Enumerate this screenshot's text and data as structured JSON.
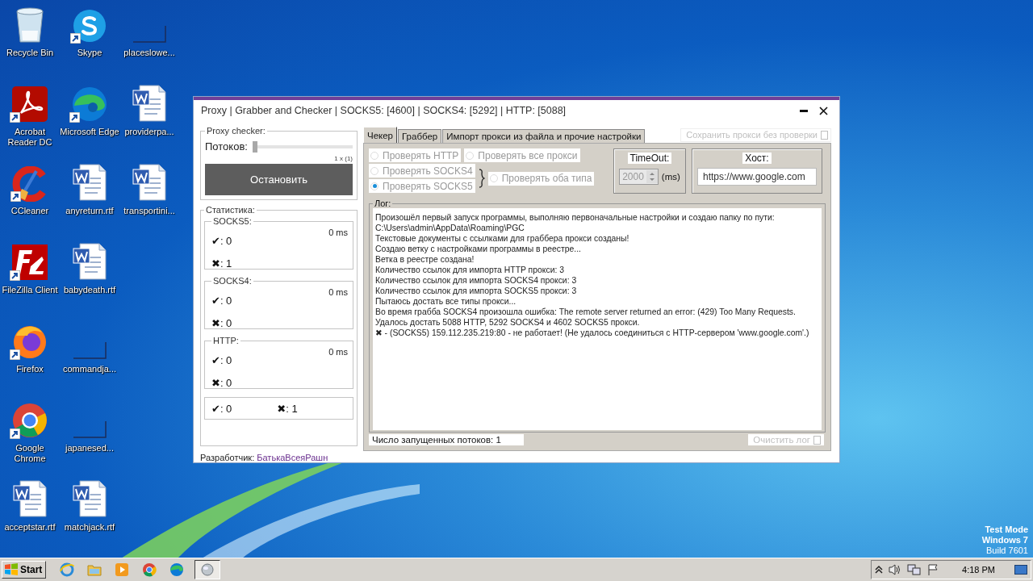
{
  "desktop": {
    "columns": [
      {
        "icons": [
          {
            "label": "Recycle Bin",
            "kind": "recycle",
            "shortcut": false
          },
          {
            "label": "Acrobat Reader DC",
            "kind": "pdf",
            "shortcut": true
          },
          {
            "label": "CCleaner",
            "kind": "ccleaner",
            "shortcut": true
          },
          {
            "label": "FileZilla Client",
            "kind": "filezilla",
            "shortcut": true
          },
          {
            "label": "Firefox",
            "kind": "firefox",
            "shortcut": true
          },
          {
            "label": "Google Chrome",
            "kind": "chrome",
            "shortcut": true
          },
          {
            "label": "acceptstar.rtf",
            "kind": "word",
            "shortcut": false
          }
        ]
      },
      {
        "icons": [
          {
            "label": "Skype",
            "kind": "skype",
            "shortcut": true
          },
          {
            "label": "Microsoft Edge",
            "kind": "edge",
            "shortcut": true
          },
          {
            "label": "anyreturn.rtf",
            "kind": "word",
            "shortcut": false
          },
          {
            "label": "babydeath.rtf",
            "kind": "word",
            "shortcut": false
          },
          {
            "label": "commandja...",
            "kind": "blank",
            "shortcut": false
          },
          {
            "label": "japanesed...",
            "kind": "blank",
            "shortcut": false
          },
          {
            "label": "matchjack.rtf",
            "kind": "word",
            "shortcut": false
          }
        ]
      },
      {
        "icons": [
          {
            "label": "placeslowe...",
            "kind": "blank",
            "shortcut": false
          },
          {
            "label": "providerpa...",
            "kind": "word",
            "shortcut": false
          },
          {
            "label": "transportini...",
            "kind": "word",
            "shortcut": false
          }
        ]
      }
    ]
  },
  "window": {
    "title": "Proxy | Grabber and Checker | SOCKS5: [4600] | SOCKS4: [5292] | HTTP: [5088]",
    "proxy_checker": {
      "legend": "Proxy checker:",
      "threads_label": "Потоков:",
      "threads_slider": {
        "level": 0
      },
      "threads_reading": "1 x (1)",
      "stop_button": "Остановить"
    },
    "statistics": {
      "legend": "Статистика:",
      "groups": [
        {
          "title": "SOCKS5:",
          "time": "0 ms",
          "good": "✔: 0",
          "bad": "✖: 1"
        },
        {
          "title": "SOCKS4:",
          "time": "0 ms",
          "good": "✔: 0",
          "bad": "✖: 0"
        },
        {
          "title": "HTTP:",
          "time": "0 ms",
          "good": "✔: 0",
          "bad": "✖: 0"
        }
      ],
      "totals": {
        "good": "✔: 0",
        "bad": "✖: 1"
      }
    },
    "developer": {
      "label": "Разработчик:",
      "name": "БатькаВсеяРашн"
    },
    "tabs": [
      {
        "label": "Чекер",
        "selected": true
      },
      {
        "label": "Граббер",
        "selected": false
      },
      {
        "label": "Импорт прокси из файла и прочие настройки",
        "selected": false
      }
    ],
    "save_without_check": {
      "label": "Сохранить прокси без проверки",
      "checked": false
    },
    "check_options": [
      {
        "label": "Проверять HTTP",
        "selected": false
      },
      {
        "label": "Проверять все прокси",
        "selected": false
      },
      {
        "label": "Проверять SOCKS4",
        "selected": false
      },
      {
        "label": "Проверять SOCKS5",
        "selected": true
      },
      {
        "label": "Проверять оба типа",
        "selected": false
      }
    ],
    "timeout": {
      "label": "TimeOut:",
      "value": "2000",
      "unit": "(ms)"
    },
    "host": {
      "label": "Хост:",
      "value": "https://www.google.com"
    },
    "log": {
      "legend": "Лог:",
      "lines": [
        "Произошёл первый запуск программы, выполняю первоначальные настройки и создаю папку по пути: C:\\Users\\admin\\AppData\\Roaming\\PGC",
        "Текстовые документы с ссылками для граббера прокси созданы!",
        "Создаю ветку с настройками программы в реестре...",
        "Ветка в реестре создана!",
        "Количество ссылок для импорта HTTP прокси: 3",
        "Количество ссылок для импорта SOCKS4 прокси: 3",
        "Количество ссылок для импорта SOCKS5 прокси: 3",
        "Пытаюсь достать все типы прокси...",
        "Во время грабба SOCKS4 произошла ошибка: The remote server returned an error: (429) Too Many Requests.",
        "Удалось достать 5088 HTTP, 5292 SOCKS4 и 4602 SOCKS5 прокси.",
        "✖ - (SOCKS5) 159.112.235.219:80 - не работает! (Не удалось соединиться с HTTP-сервером 'www.google.com'.)"
      ]
    },
    "threads_status": "Число запущенных потоков: 1",
    "clear_log_button": "Очистить лог"
  },
  "taskbar": {
    "start": "Start",
    "apps": [
      {
        "kind": "ie",
        "running": false
      },
      {
        "kind": "explorer",
        "running": false
      },
      {
        "kind": "media",
        "running": false
      },
      {
        "kind": "chrome",
        "running": false
      },
      {
        "kind": "edge",
        "running": false
      },
      {
        "kind": "globe",
        "running": true
      }
    ],
    "tray": [
      {
        "kind": "chevron"
      },
      {
        "kind": "speaker"
      },
      {
        "kind": "network"
      },
      {
        "kind": "flag"
      }
    ],
    "clock": "4:18 PM"
  },
  "os_notice": [
    "Test Mode",
    "Windows 7",
    "Build 7601"
  ]
}
